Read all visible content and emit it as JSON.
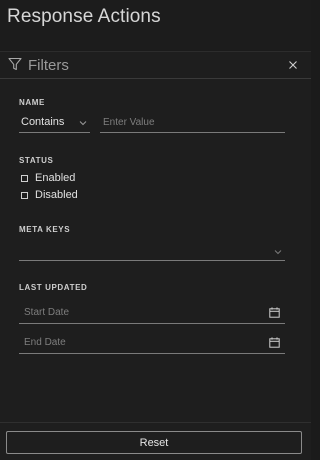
{
  "page": {
    "title": "Response Actions"
  },
  "filters": {
    "title": "Filters",
    "name": {
      "label": "NAME",
      "operator": "Contains",
      "value_placeholder": "Enter Value"
    },
    "status": {
      "label": "STATUS",
      "options": [
        {
          "label": "Enabled",
          "checked": false
        },
        {
          "label": "Disabled",
          "checked": false
        }
      ]
    },
    "meta_keys": {
      "label": "META KEYS",
      "value": ""
    },
    "last_updated": {
      "label": "LAST UPDATED",
      "start_placeholder": "Start Date",
      "end_placeholder": "End Date"
    },
    "reset_label": "Reset"
  }
}
